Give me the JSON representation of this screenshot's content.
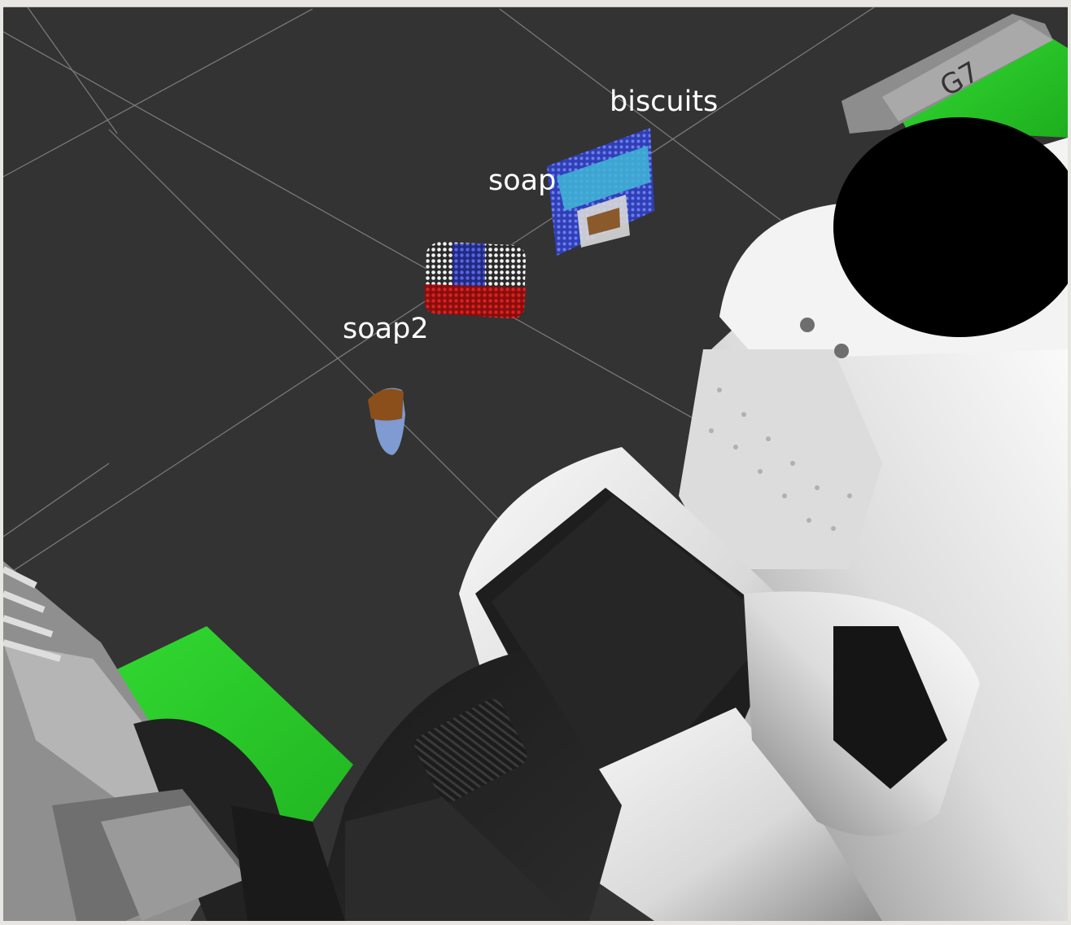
{
  "viewport": {
    "background": "#333333",
    "grid_color": "#9a9a9a",
    "detected_objects": [
      {
        "label": "biscuits",
        "cloud_colors": [
          "#3a4bd0",
          "#41b6d6",
          "#e0e0e0",
          "#8b5a2b"
        ]
      },
      {
        "label": "soap",
        "cloud_colors": [
          "#f0f0f0",
          "#3a44c8",
          "#c41818"
        ]
      },
      {
        "label": "soap2",
        "cloud_colors": [
          "#8b4f1c",
          "#7f9bd1",
          "#cfcfcf"
        ]
      }
    ],
    "robot": {
      "body_color": "#e6e6e6",
      "accent_color": "#2fd12f"
    }
  }
}
